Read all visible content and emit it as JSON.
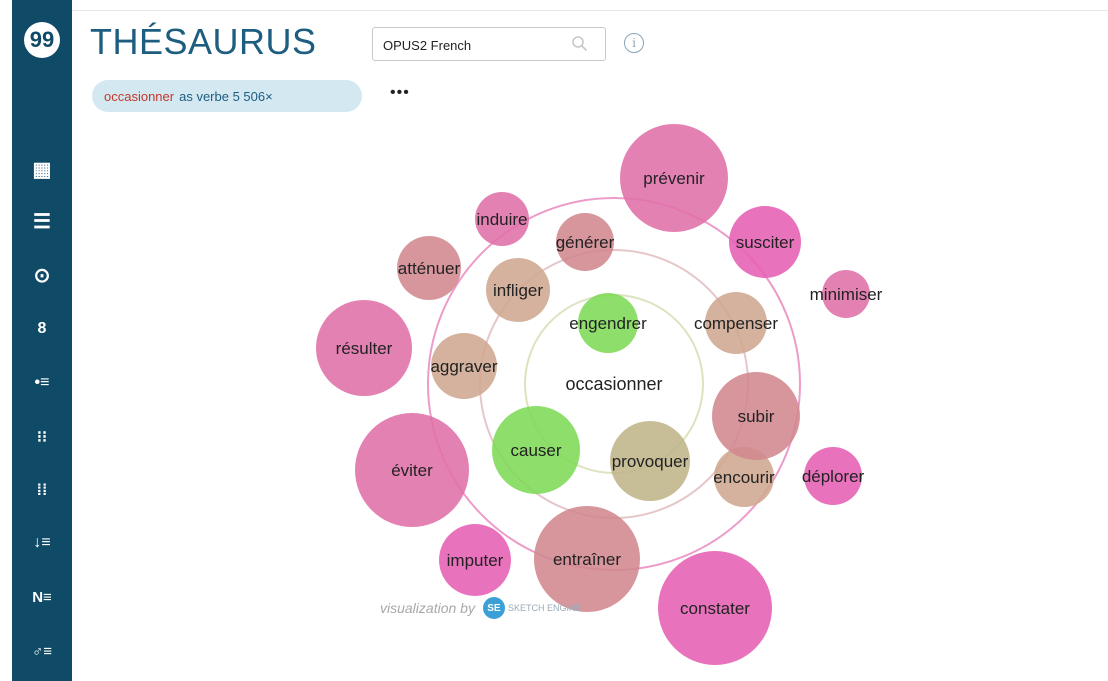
{
  "app": {
    "logo": "99",
    "title": "THÉSAURUS"
  },
  "sidebar": {
    "items": [
      {
        "icon": "dashboard-icon",
        "glyph": "▦"
      },
      {
        "icon": "list-icon",
        "glyph": "☰"
      },
      {
        "icon": "target-icon",
        "glyph": "⊙"
      },
      {
        "icon": "rings-icon",
        "glyph": "8"
      },
      {
        "icon": "bullet-list-icon",
        "glyph": "•≡"
      },
      {
        "icon": "dual-list-icon",
        "glyph": "⁝⁝"
      },
      {
        "icon": "grid-list-icon",
        "glyph": "⁞⁞"
      },
      {
        "icon": "sort-list-icon",
        "glyph": "↓≡"
      },
      {
        "icon": "n-list-icon",
        "glyph": "N≡"
      },
      {
        "icon": "person-list-icon",
        "glyph": "♂≡"
      }
    ]
  },
  "search": {
    "value": "OPUS2 French"
  },
  "query": {
    "word": "occasionner",
    "details": "as verbe 5 506×",
    "more_label": "•••"
  },
  "visualization": {
    "center_word": "occasionner",
    "colors": {
      "green": "#7ed957",
      "olive": "#bfb58a",
      "tan": "#cfa78f",
      "mauve": "#d0888e",
      "pink": "#e070a8",
      "magenta": "#e65fb4"
    },
    "words": [
      {
        "text": "engendrer",
        "tone": "green"
      },
      {
        "text": "causer",
        "tone": "green"
      },
      {
        "text": "provoquer",
        "tone": "olive"
      },
      {
        "text": "infliger",
        "tone": "tan"
      },
      {
        "text": "aggraver",
        "tone": "tan"
      },
      {
        "text": "compenser",
        "tone": "tan"
      },
      {
        "text": "encourir",
        "tone": "tan"
      },
      {
        "text": "générer",
        "tone": "mauve"
      },
      {
        "text": "atténuer",
        "tone": "mauve"
      },
      {
        "text": "subir",
        "tone": "mauve"
      },
      {
        "text": "entraîner",
        "tone": "mauve"
      },
      {
        "text": "induire",
        "tone": "pink"
      },
      {
        "text": "prévenir",
        "tone": "pink"
      },
      {
        "text": "résulter",
        "tone": "pink"
      },
      {
        "text": "éviter",
        "tone": "pink"
      },
      {
        "text": "susciter",
        "tone": "magenta"
      },
      {
        "text": "minimiser",
        "tone": "pink"
      },
      {
        "text": "déplorer",
        "tone": "magenta"
      },
      {
        "text": "imputer",
        "tone": "magenta"
      },
      {
        "text": "constater",
        "tone": "magenta"
      }
    ],
    "credit": "visualization by",
    "credit_brand": "SKETCH ENGINE"
  }
}
